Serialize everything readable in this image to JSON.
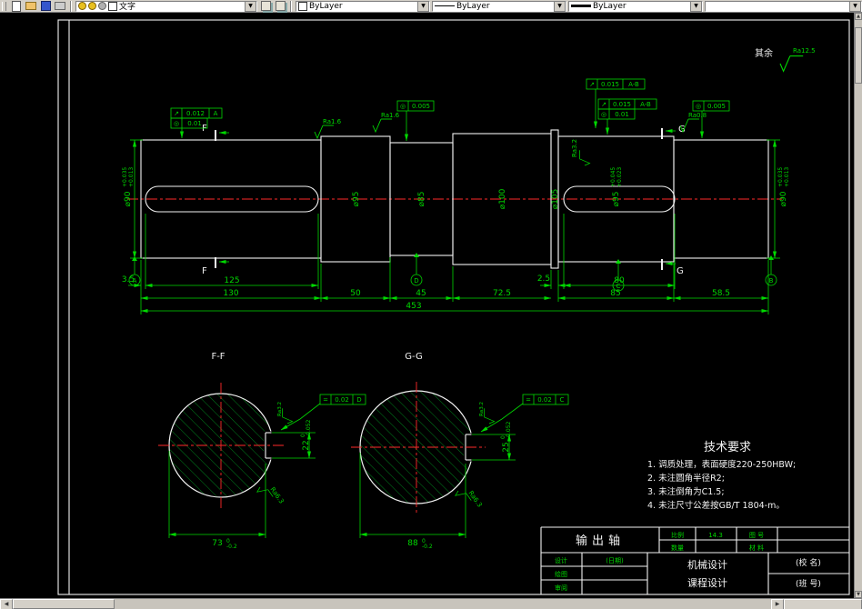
{
  "toolbar": {
    "layer_name": "文字",
    "color": "ByLayer",
    "linetype": "ByLayer",
    "lineweight": "ByLayer",
    "plotstyle": ""
  },
  "drawing": {
    "general_roughness": {
      "prefix": "其余",
      "value": "Ra12.5"
    },
    "roughness": {
      "r1": "Ra1.6",
      "r2": "Ra1.6",
      "r3": "Ra0.8",
      "r4": "Ra3.2",
      "ff_side": "Ra3.2",
      "ff_corner": "Ra6.3",
      "gg_side": "Ra3.2",
      "gg_corner": "Ra6.3"
    },
    "tol_frames": {
      "f1a": {
        "sym": "↗",
        "val": "0.012",
        "datum": "A"
      },
      "f1b": {
        "sym": "◎",
        "val": "0.01"
      },
      "f2": {
        "sym": "◎",
        "val": "0.005"
      },
      "f3": {
        "sym": "↗",
        "val": "0.015",
        "datum": "A-B"
      },
      "f4a": {
        "sym": "↗",
        "val": "0.015",
        "datum": "A-B"
      },
      "f4b": {
        "sym": "◎",
        "val": "0.01"
      },
      "f5": {
        "sym": "◎",
        "val": "0.005"
      },
      "ff": {
        "sym": "=",
        "val": "0.02",
        "datum": "D"
      },
      "gg": {
        "sym": "=",
        "val": "0.02",
        "datum": "C"
      }
    },
    "diameters": {
      "d1": {
        "v": "⌀90",
        "up": "+0.035",
        "dn": "+0.013"
      },
      "d2": {
        "v": "⌀95"
      },
      "d3": {
        "v": "⌀85"
      },
      "d4": {
        "v": "⌀100"
      },
      "d5": {
        "v": "⌀105"
      },
      "d6": {
        "v": "⌀95",
        "up": "+0.045",
        "dn": "+0.023"
      },
      "d7": {
        "v": "⌀90",
        "up": "+0.035",
        "dn": "+0.013"
      }
    },
    "lengths": {
      "l35": "3.5",
      "l125": "125",
      "l130": "130",
      "l50": "50",
      "l45": "45",
      "l725": "72.5",
      "l25": "2.5",
      "l80": "80",
      "l85": "85",
      "l585": "58.5",
      "l453": "453"
    },
    "datums": {
      "a": "A",
      "b": "B",
      "c": "C",
      "d": "D"
    },
    "cuts": {
      "f": "F",
      "g": "G"
    },
    "sections": {
      "ff": {
        "label": "F-F",
        "side": {
          "v": "22",
          "up": "0",
          "dn": "-0.052"
        },
        "bottom": {
          "v": "73",
          "up": "0",
          "dn": "-0.2"
        }
      },
      "gg": {
        "label": "G-G",
        "side": {
          "v": "25",
          "up": "0",
          "dn": "-0.052"
        },
        "bottom": {
          "v": "88",
          "up": "0",
          "dn": "-0.2"
        }
      }
    },
    "tech_req": {
      "title": "技术要求",
      "items": [
        "1. 调质处理，表面硬度220-250HBW;",
        "2. 未注圆角半径R2;",
        "3. 未注倒角为C1.5;",
        "4. 未注尺寸公差按GB/T 1804-m。"
      ]
    },
    "title_block": {
      "part": "输出轴",
      "scale_label": "比例",
      "scale": "14.3",
      "qty_label": "数量",
      "drawno_label": "图 号",
      "material_label": "材 料",
      "design": "设计",
      "draw": "绘图",
      "review": "审阅",
      "date": "(日期)",
      "course1": "机械设计",
      "course2": "课程设计",
      "school": "(校 名)",
      "klass": "(班 号)"
    }
  }
}
